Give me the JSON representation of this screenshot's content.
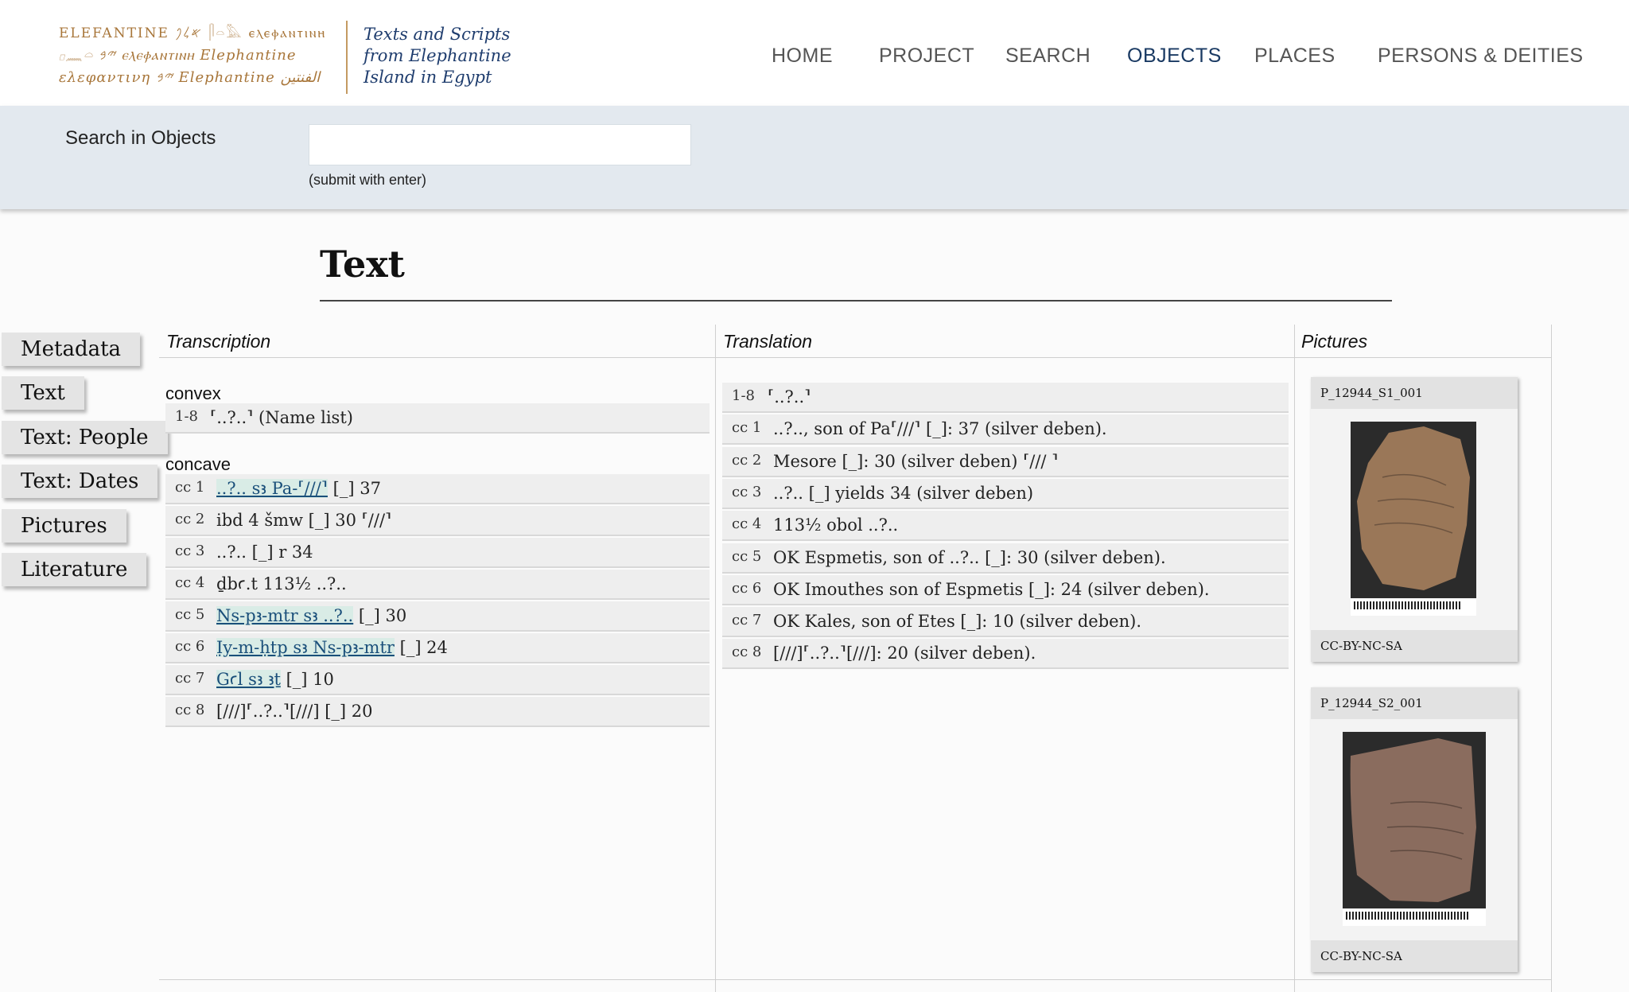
{
  "header": {
    "logo": {
      "lines": [
        "ELEFANTINE 𐤀𐤋𐤐 𓋴𓏏𓅓 ⲉⲗⲉⲫⲁⲛⲧⲓⲛⲏ",
        "𓊪𓈖𓏏 𐤉𐤁 ⲉⲗⲉⲫⲁⲛⲧⲓⲛⲏ Elephantine",
        "ελεφαντινη 𐤉𐤁 Elephantine الفنتين"
      ]
    },
    "tagline": [
      "Texts and Scripts",
      "from Elephantine",
      "Island in Egypt"
    ],
    "nav": [
      {
        "label": "HOME"
      },
      {
        "label": "PROJECT"
      },
      {
        "label": "SEARCH"
      },
      {
        "label": "OBJECTS"
      },
      {
        "label": "PLACES"
      },
      {
        "label": "PERSONS & DEITIES"
      }
    ],
    "active_color": "#1a3a63"
  },
  "search": {
    "label": "Search in Objects",
    "value": "",
    "hint": "(submit with enter)"
  },
  "page_title": "Text",
  "sidebar": {
    "tabs": [
      {
        "label": "Metadata"
      },
      {
        "label": "Text"
      },
      {
        "label": "Text: People"
      },
      {
        "label": "Text: Dates"
      },
      {
        "label": "Pictures"
      },
      {
        "label": "Literature"
      }
    ]
  },
  "columns": {
    "transcription": "Transcription",
    "translation": "Translation",
    "pictures": "Pictures"
  },
  "transcription": {
    "convex": {
      "label": "convex",
      "rows": [
        {
          "num": "1-8",
          "text": "⸢..?..⸣ (Name list)"
        }
      ]
    },
    "concave": {
      "label": "concave",
      "rows": [
        {
          "num": "cc 1",
          "link": "..?.. sꜣ Pa-⸢///⸣",
          "rest": "[_] 37"
        },
        {
          "num": "cc 2",
          "link": "",
          "rest": "ibd 4 šmw [_] 30 ⸢///⸣"
        },
        {
          "num": "cc 3",
          "link": "",
          "rest": "..?.. [_] r 34"
        },
        {
          "num": "cc 4",
          "link": "",
          "rest": "ḏbꜥ.t 113½ ..?.."
        },
        {
          "num": "cc 5",
          "link": "Ns-pꜣ-mtr sꜣ ..?..",
          "rest": "[_] 30"
        },
        {
          "num": "cc 6",
          "link": "Ịy-m-ḥtp sꜣ Ns-pꜣ-mtr",
          "rest": "[_] 24"
        },
        {
          "num": "cc 7",
          "link": "Gꜥl sꜣ ꜣṯ",
          "rest": "[_] 10"
        },
        {
          "num": "cc 8",
          "link": "",
          "rest": "[///]⸢..?..⸣[///] [_] 20"
        }
      ]
    }
  },
  "translation": {
    "rows": [
      {
        "num": "1-8",
        "text": "⸢..?..⸣"
      },
      {
        "num": "cc 1",
        "text": "..?.., son of Pa⸢///⸣ [_]: 37 (silver deben)."
      },
      {
        "num": "cc 2",
        "text": "Mesore [_]: 30 (silver deben) ⸢/// ⸣"
      },
      {
        "num": "cc 3",
        "text": "..?.. [_] yields 34 (silver deben)"
      },
      {
        "num": "cc 4",
        "text": "113½ obol ..?.."
      },
      {
        "num": "cc 5",
        "text": "OK Espmetis, son of ..?.. [_]: 30 (silver deben)."
      },
      {
        "num": "cc 6",
        "text": "OK Imouthes son of Espmetis [_]: 24 (silver deben)."
      },
      {
        "num": "cc 7",
        "text": "OK Kales, son of Etes [_]: 10 (silver deben)."
      },
      {
        "num": "cc 8",
        "text": "[///]⸢..?..⸣[///]: 20 (silver deben)."
      }
    ]
  },
  "pictures": [
    {
      "id": "P_12944_S1_001",
      "license": "CC-BY-NC-SA"
    },
    {
      "id": "P_12944_S2_001",
      "license": "CC-BY-NC-SA"
    }
  ]
}
